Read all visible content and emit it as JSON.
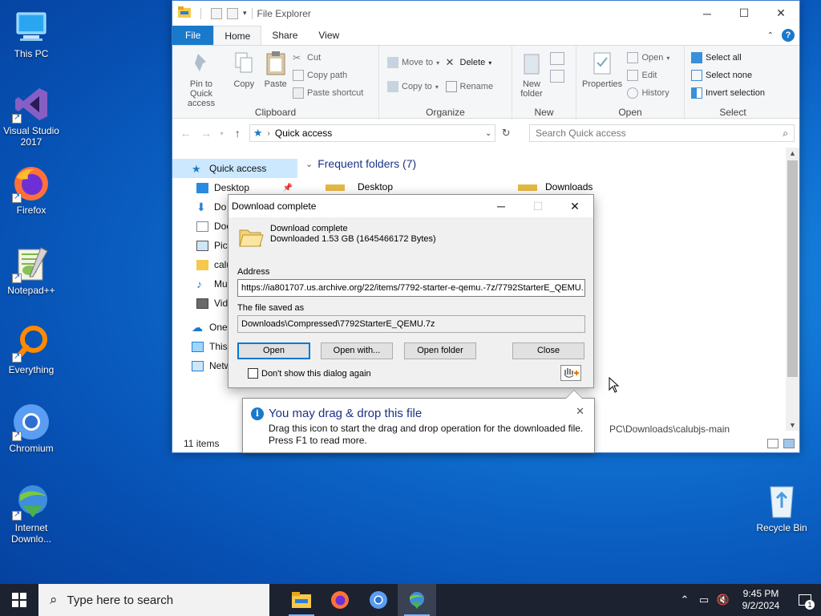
{
  "desktop": {
    "icons": [
      {
        "label": "This PC"
      },
      {
        "label": "Visual Studio 2017"
      },
      {
        "label": "Firefox"
      },
      {
        "label": "Notepad++"
      },
      {
        "label": "Everything"
      },
      {
        "label": "Chromium"
      },
      {
        "label": "Internet Downlo..."
      },
      {
        "label": "Recycle Bin"
      }
    ]
  },
  "explorer": {
    "title": "File Explorer",
    "tabs": {
      "file": "File",
      "home": "Home",
      "share": "Share",
      "view": "View"
    },
    "ribbon": {
      "clipboard": {
        "label": "Clipboard",
        "pin": "Pin to Quick access",
        "copy": "Copy",
        "paste": "Paste",
        "cut": "Cut",
        "copy_path": "Copy path",
        "paste_shortcut": "Paste shortcut"
      },
      "organize": {
        "label": "Organize",
        "move_to": "Move to",
        "copy_to": "Copy to",
        "delete": "Delete",
        "rename": "Rename"
      },
      "new": {
        "label": "New",
        "new_folder": "New folder"
      },
      "open": {
        "label": "Open",
        "properties": "Properties",
        "open": "Open",
        "edit": "Edit",
        "history": "History"
      },
      "select": {
        "label": "Select",
        "select_all": "Select all",
        "select_none": "Select none",
        "invert": "Invert selection"
      }
    },
    "address": {
      "location": "Quick access",
      "search_placeholder": "Search Quick access"
    },
    "nav": {
      "quick_access": "Quick access",
      "items": [
        "Desktop",
        "Do",
        "Doc",
        "Pict",
        "calu",
        "Mu",
        "Vid"
      ],
      "onedrive": "OneD",
      "this_pc": "This",
      "network": "Netw"
    },
    "main": {
      "group_title": "Frequent folders (7)",
      "folders": [
        "Desktop",
        "Downloads"
      ],
      "partial_path": "PC\\Downloads\\calubjs-main"
    },
    "status": {
      "items": "11 items"
    }
  },
  "dialog": {
    "title": "Download complete",
    "heading": "Download complete",
    "size_text": "Downloaded 1.53  GB (1645466172 Bytes)",
    "address_label": "Address",
    "address_value": "https://ia801707.us.archive.org/22/items/7792-starter-e-qemu.-7z/7792StarterE_QEMU.",
    "saved_label": "The file saved as",
    "saved_value": "Downloads\\Compressed\\7792StarterE_QEMU.7z",
    "buttons": {
      "open": "Open",
      "open_with": "Open with...",
      "open_folder": "Open folder",
      "close": "Close"
    },
    "dont_show": "Don't show this dialog again"
  },
  "tooltip": {
    "title": "You may drag & drop this file",
    "line1": "Drag this icon to start the drag and drop operation for the downloaded file.",
    "line2": "Press F1 to read more."
  },
  "taskbar": {
    "search_placeholder": "Type here to search",
    "time": "9:45 PM",
    "date": "9/2/2024",
    "notification_count": "1"
  }
}
